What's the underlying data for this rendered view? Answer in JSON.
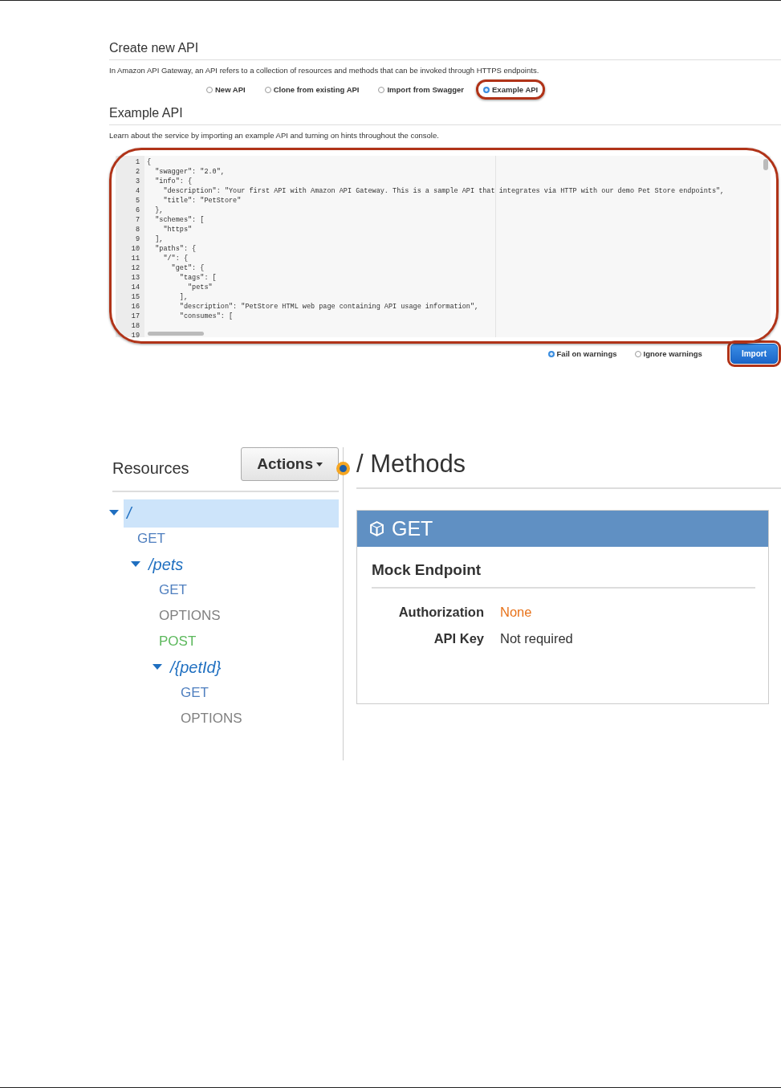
{
  "create_section": {
    "title": "Create new API",
    "description": "In Amazon API Gateway, an API refers to a collection of resources and methods that can be invoked through HTTPS endpoints.",
    "options": [
      {
        "label": "New API",
        "selected": false,
        "highlighted": false
      },
      {
        "label": "Clone from existing API",
        "selected": false,
        "highlighted": false
      },
      {
        "label": "Import from Swagger",
        "selected": false,
        "highlighted": false
      },
      {
        "label": "Example API",
        "selected": true,
        "highlighted": true
      }
    ]
  },
  "example_section": {
    "title": "Example API",
    "description": "Learn about the service by importing an example API and turning on hints throughout the console."
  },
  "editor": {
    "highlighted": true,
    "line_numbers": [
      "1",
      "2",
      "3",
      "4",
      "5",
      "6",
      "7",
      "8",
      "9",
      "10",
      "11",
      "12",
      "13",
      "14",
      "15",
      "16",
      "17",
      "18",
      "19"
    ],
    "lines": [
      "{",
      "  \"swagger\": \"2.0\",",
      "  \"info\": {",
      "    \"description\": \"Your first API with Amazon API Gateway. This is a sample API that integrates via HTTP with our demo Pet Store endpoints\",",
      "    \"title\": \"PetStore\"",
      "  },",
      "  \"schemes\": [",
      "    \"https\"",
      "  ],",
      "  \"paths\": {",
      "    \"/\": {",
      "      \"get\": {",
      "        \"tags\": [",
      "          \"pets\"",
      "        ],",
      "        \"description\": \"PetStore HTML web page containing API usage information\",",
      "        \"consumes\": ["
    ]
  },
  "warning_options": [
    {
      "label": "Fail on warnings",
      "selected": true
    },
    {
      "label": "Ignore warnings",
      "selected": false
    }
  ],
  "import_button": {
    "label": "Import",
    "highlighted": true
  },
  "resources": {
    "title": "Resources",
    "actions_button": "Actions",
    "tree": [
      {
        "path": "/",
        "selected": true,
        "expanded": true,
        "children": [
          {
            "method": "GET",
            "color": "#4f7fbf"
          },
          {
            "path": "/pets",
            "selected": false,
            "expanded": true,
            "children": [
              {
                "method": "GET",
                "color": "#4f7fbf"
              },
              {
                "method": "OPTIONS",
                "color": "#808080"
              },
              {
                "method": "POST",
                "color": "#5cb85c"
              },
              {
                "path": "/{petId}",
                "selected": false,
                "expanded": true,
                "children": [
                  {
                    "method": "GET",
                    "color": "#4f7fbf"
                  },
                  {
                    "method": "OPTIONS",
                    "color": "#808080"
                  }
                ]
              }
            ]
          }
        ]
      }
    ]
  },
  "methods": {
    "title": "/ Methods",
    "card": {
      "method": "GET",
      "endpoint": "Mock Endpoint",
      "fields": [
        {
          "label": "Authorization",
          "value": "None",
          "kind": "warning"
        },
        {
          "label": "API Key",
          "value": "Not required",
          "kind": "plain"
        }
      ]
    }
  }
}
